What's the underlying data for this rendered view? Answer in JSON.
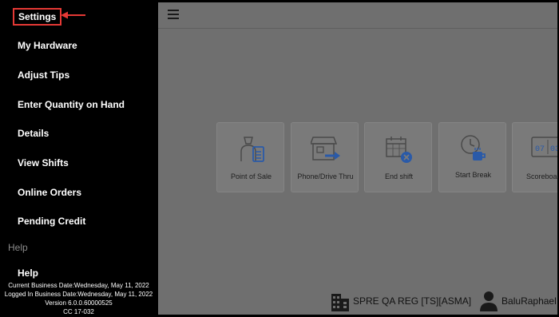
{
  "sidebar": {
    "settings_label": "Settings",
    "items": [
      {
        "label": "My Hardware"
      },
      {
        "label": "Adjust Tips"
      },
      {
        "label": "Enter Quantity on Hand"
      },
      {
        "label": "Details"
      },
      {
        "label": "View Shifts"
      },
      {
        "label": "Online Orders"
      },
      {
        "label": "Pending Credit"
      }
    ],
    "section_label": "Help",
    "help_label": "Help",
    "footer": {
      "business_date": "Current Business Date:Wednesday, May 11, 2022",
      "logged_in_date": "Logged In Business Date:Wednesday, May 11, 2022",
      "version": "Version 6.0.0.60000525",
      "cc": "CC 17-032"
    }
  },
  "main": {
    "tiles": [
      {
        "label": "Point of Sale",
        "icon": "cashier-icon"
      },
      {
        "label": "Phone/Drive Thru",
        "icon": "storefront-icon"
      },
      {
        "label": "End shift",
        "icon": "calendar-close-icon"
      },
      {
        "label": "Start Break",
        "icon": "clock-coffee-icon"
      },
      {
        "label": "Scoreboa",
        "icon": "scoreboard-icon"
      }
    ],
    "status": {
      "store": "SPRE QA REG [TS][ASMA]",
      "user": "BaluRaphael"
    }
  },
  "colors": {
    "highlight": "#e53935",
    "icon_accent": "#2a5aa8",
    "sidebar_bg": "#000000",
    "main_bg": "#6f6f6f"
  }
}
